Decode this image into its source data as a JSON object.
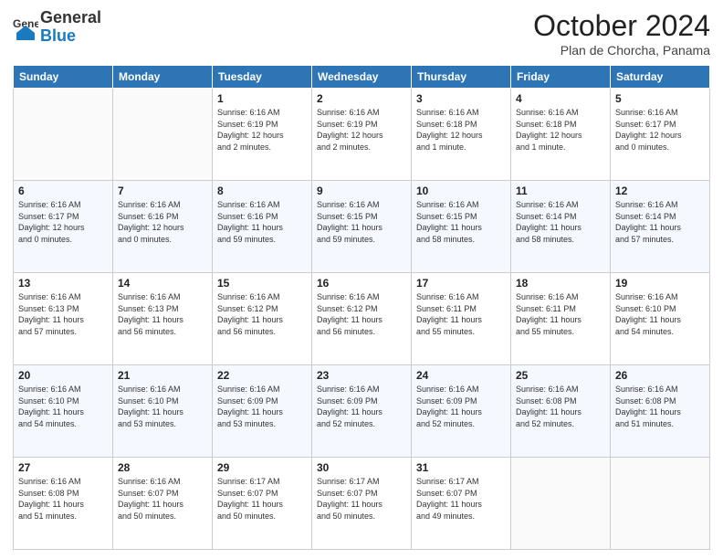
{
  "header": {
    "logo_general": "General",
    "logo_blue": "Blue",
    "month": "October 2024",
    "location": "Plan de Chorcha, Panama"
  },
  "days_of_week": [
    "Sunday",
    "Monday",
    "Tuesday",
    "Wednesday",
    "Thursday",
    "Friday",
    "Saturday"
  ],
  "weeks": [
    [
      {
        "day": "",
        "info": ""
      },
      {
        "day": "",
        "info": ""
      },
      {
        "day": "1",
        "info": "Sunrise: 6:16 AM\nSunset: 6:19 PM\nDaylight: 12 hours\nand 2 minutes."
      },
      {
        "day": "2",
        "info": "Sunrise: 6:16 AM\nSunset: 6:19 PM\nDaylight: 12 hours\nand 2 minutes."
      },
      {
        "day": "3",
        "info": "Sunrise: 6:16 AM\nSunset: 6:18 PM\nDaylight: 12 hours\nand 1 minute."
      },
      {
        "day": "4",
        "info": "Sunrise: 6:16 AM\nSunset: 6:18 PM\nDaylight: 12 hours\nand 1 minute."
      },
      {
        "day": "5",
        "info": "Sunrise: 6:16 AM\nSunset: 6:17 PM\nDaylight: 12 hours\nand 0 minutes."
      }
    ],
    [
      {
        "day": "6",
        "info": "Sunrise: 6:16 AM\nSunset: 6:17 PM\nDaylight: 12 hours\nand 0 minutes."
      },
      {
        "day": "7",
        "info": "Sunrise: 6:16 AM\nSunset: 6:16 PM\nDaylight: 12 hours\nand 0 minutes."
      },
      {
        "day": "8",
        "info": "Sunrise: 6:16 AM\nSunset: 6:16 PM\nDaylight: 11 hours\nand 59 minutes."
      },
      {
        "day": "9",
        "info": "Sunrise: 6:16 AM\nSunset: 6:15 PM\nDaylight: 11 hours\nand 59 minutes."
      },
      {
        "day": "10",
        "info": "Sunrise: 6:16 AM\nSunset: 6:15 PM\nDaylight: 11 hours\nand 58 minutes."
      },
      {
        "day": "11",
        "info": "Sunrise: 6:16 AM\nSunset: 6:14 PM\nDaylight: 11 hours\nand 58 minutes."
      },
      {
        "day": "12",
        "info": "Sunrise: 6:16 AM\nSunset: 6:14 PM\nDaylight: 11 hours\nand 57 minutes."
      }
    ],
    [
      {
        "day": "13",
        "info": "Sunrise: 6:16 AM\nSunset: 6:13 PM\nDaylight: 11 hours\nand 57 minutes."
      },
      {
        "day": "14",
        "info": "Sunrise: 6:16 AM\nSunset: 6:13 PM\nDaylight: 11 hours\nand 56 minutes."
      },
      {
        "day": "15",
        "info": "Sunrise: 6:16 AM\nSunset: 6:12 PM\nDaylight: 11 hours\nand 56 minutes."
      },
      {
        "day": "16",
        "info": "Sunrise: 6:16 AM\nSunset: 6:12 PM\nDaylight: 11 hours\nand 56 minutes."
      },
      {
        "day": "17",
        "info": "Sunrise: 6:16 AM\nSunset: 6:11 PM\nDaylight: 11 hours\nand 55 minutes."
      },
      {
        "day": "18",
        "info": "Sunrise: 6:16 AM\nSunset: 6:11 PM\nDaylight: 11 hours\nand 55 minutes."
      },
      {
        "day": "19",
        "info": "Sunrise: 6:16 AM\nSunset: 6:10 PM\nDaylight: 11 hours\nand 54 minutes."
      }
    ],
    [
      {
        "day": "20",
        "info": "Sunrise: 6:16 AM\nSunset: 6:10 PM\nDaylight: 11 hours\nand 54 minutes."
      },
      {
        "day": "21",
        "info": "Sunrise: 6:16 AM\nSunset: 6:10 PM\nDaylight: 11 hours\nand 53 minutes."
      },
      {
        "day": "22",
        "info": "Sunrise: 6:16 AM\nSunset: 6:09 PM\nDaylight: 11 hours\nand 53 minutes."
      },
      {
        "day": "23",
        "info": "Sunrise: 6:16 AM\nSunset: 6:09 PM\nDaylight: 11 hours\nand 52 minutes."
      },
      {
        "day": "24",
        "info": "Sunrise: 6:16 AM\nSunset: 6:09 PM\nDaylight: 11 hours\nand 52 minutes."
      },
      {
        "day": "25",
        "info": "Sunrise: 6:16 AM\nSunset: 6:08 PM\nDaylight: 11 hours\nand 52 minutes."
      },
      {
        "day": "26",
        "info": "Sunrise: 6:16 AM\nSunset: 6:08 PM\nDaylight: 11 hours\nand 51 minutes."
      }
    ],
    [
      {
        "day": "27",
        "info": "Sunrise: 6:16 AM\nSunset: 6:08 PM\nDaylight: 11 hours\nand 51 minutes."
      },
      {
        "day": "28",
        "info": "Sunrise: 6:16 AM\nSunset: 6:07 PM\nDaylight: 11 hours\nand 50 minutes."
      },
      {
        "day": "29",
        "info": "Sunrise: 6:17 AM\nSunset: 6:07 PM\nDaylight: 11 hours\nand 50 minutes."
      },
      {
        "day": "30",
        "info": "Sunrise: 6:17 AM\nSunset: 6:07 PM\nDaylight: 11 hours\nand 50 minutes."
      },
      {
        "day": "31",
        "info": "Sunrise: 6:17 AM\nSunset: 6:07 PM\nDaylight: 11 hours\nand 49 minutes."
      },
      {
        "day": "",
        "info": ""
      },
      {
        "day": "",
        "info": ""
      }
    ]
  ]
}
